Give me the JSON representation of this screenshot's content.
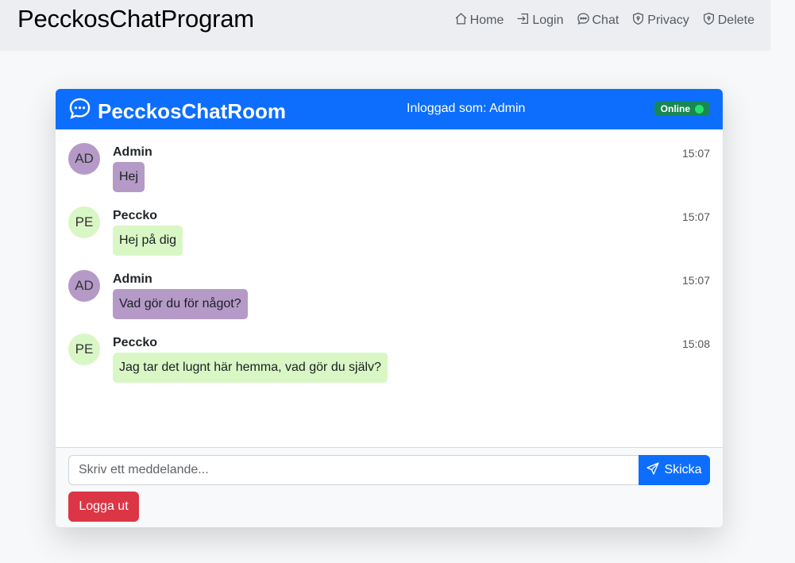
{
  "app": {
    "title": "PecckosChatProgram"
  },
  "nav": {
    "items": [
      {
        "label": "Home",
        "icon": "house-icon"
      },
      {
        "label": "Login",
        "icon": "login-icon"
      },
      {
        "label": "Chat",
        "icon": "chat-icon"
      },
      {
        "label": "Privacy",
        "icon": "shield-icon"
      },
      {
        "label": "Delete",
        "icon": "shield-icon"
      }
    ]
  },
  "chat": {
    "room_title": "PecckosChatRoom",
    "logged_in_text": "Inloggad som: Admin",
    "status": "Online",
    "messages": [
      {
        "initials": "AD",
        "sender": "Admin",
        "time": "15:07",
        "text": "Hej"
      },
      {
        "initials": "PE",
        "sender": "Peccko",
        "time": "15:07",
        "text": "Hej på dig"
      },
      {
        "initials": "AD",
        "sender": "Admin",
        "time": "15:07",
        "text": "Vad gör du för något?"
      },
      {
        "initials": "PE",
        "sender": "Peccko",
        "time": "15:08",
        "text": "Jag tar det lugnt här hemma, vad gör du själv?"
      }
    ],
    "input": {
      "placeholder": "Skriv ett meddelande...",
      "value": ""
    },
    "send_label": "Skicka",
    "logout_label": "Logga ut"
  },
  "colors": {
    "primary": "#0d6efd",
    "danger": "#dc3545",
    "online": "#198754",
    "admin_bubble": "#b59ac8",
    "peccko_bubble": "#d9f7c5"
  }
}
